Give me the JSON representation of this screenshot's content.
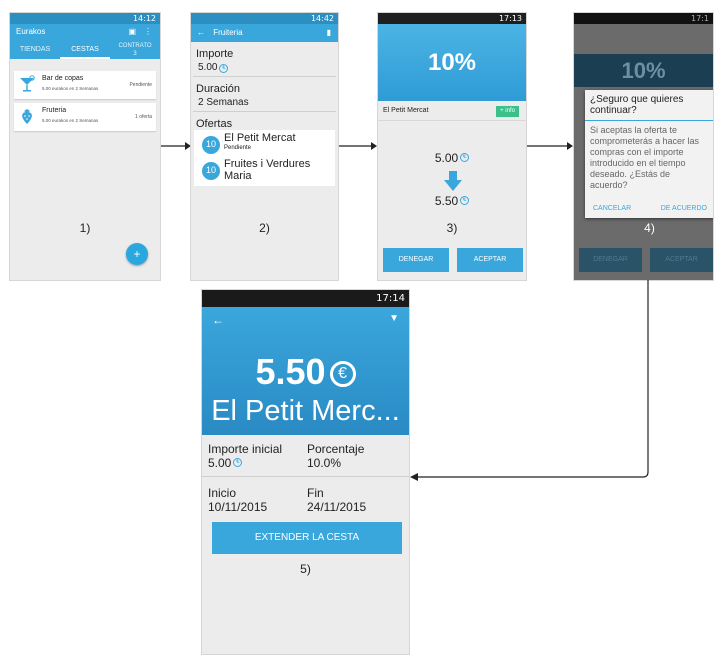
{
  "screen1": {
    "status_time": "14:12",
    "app_title": "Eurakos",
    "tabs": [
      "TIENDAS",
      "CESTAS",
      "CONTRATO"
    ],
    "contract_count": "3",
    "items": [
      {
        "title": "Bar de copas",
        "subtitle": "5.00 eurakos en 2 Semanas",
        "status": "Pendiente",
        "icon": "cocktail-icon"
      },
      {
        "title": "Fruteria",
        "subtitle": "5.00 eurakos en 2 Semanas",
        "status": "1 oferta",
        "icon": "strawberry-icon"
      }
    ],
    "caption": "1)"
  },
  "screen2": {
    "status_time": "14:42",
    "title": "Fruiteria",
    "importe_label": "Importe",
    "importe_value": "5.00",
    "duracion_label": "Duración",
    "duracion_value": "2 Semanas",
    "ofertas_label": "Ofertas",
    "offers": [
      {
        "badge": "10",
        "name": "El Petit Mercat",
        "status": "Pendiente"
      },
      {
        "badge": "10",
        "name": "Fruites i Verdures Maria",
        "status": ""
      }
    ],
    "caption": "2)"
  },
  "screen3": {
    "status_time": "17:13",
    "percent": "10%",
    "merchant": "El Petit Mercat",
    "info_label": "+ info",
    "from_amount": "5.00",
    "to_amount": "5.50",
    "deny_label": "DENEGAR",
    "accept_label": "ACEPTAR",
    "caption": "3)"
  },
  "screen4": {
    "status_time": "17:1",
    "percent": "10%",
    "dialog_title": "¿Seguro que quieres continuar?",
    "dialog_body": "Si aceptas la oferta te comprometerás a hacer las compras con el importe introducido en el tiempo deseado. ¿Estás de acuerdo?",
    "cancel_label": "CANCELAR",
    "agree_label": "DE ACUERDO",
    "deny_label": "DENEGAR",
    "accept_label": "ACEPTAR",
    "caption": "4)"
  },
  "screen5": {
    "status_time": "17:14",
    "amount": "5.50",
    "merchant": "El Petit Merc...",
    "importe_inicial_label": "Importe inicial",
    "importe_inicial_value": "5.00",
    "porcentaje_label": "Porcentaje",
    "porcentaje_value": "10.0%",
    "inicio_label": "Inicio",
    "inicio_value": "10/11/2015",
    "fin_label": "Fin",
    "fin_value": "24/11/2015",
    "extend_label": "EXTENDER LA CESTA",
    "caption": "5)"
  },
  "colors": {
    "accent": "#3aa7dc",
    "info_green": "#3cc08b"
  }
}
